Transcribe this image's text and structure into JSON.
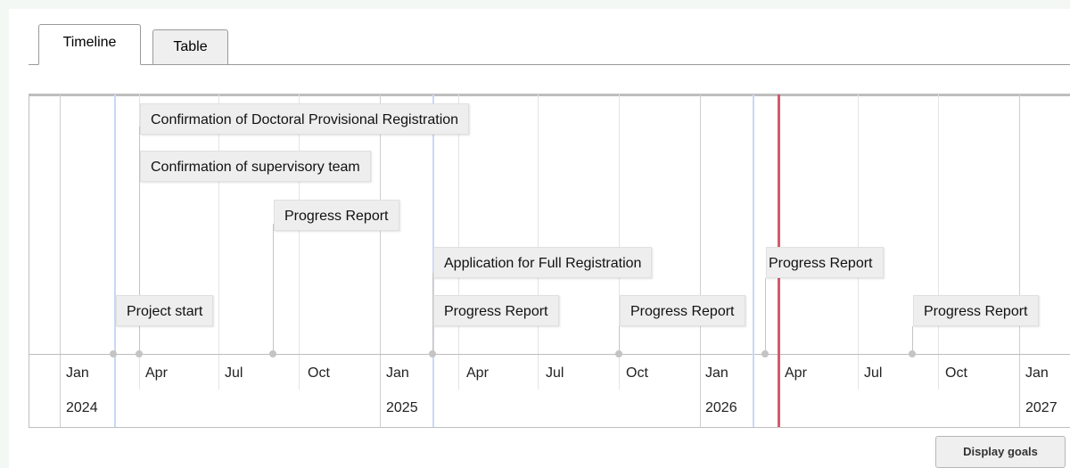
{
  "tabs": [
    {
      "label": "Timeline",
      "active": true
    },
    {
      "label": "Table",
      "active": false
    }
  ],
  "timeline": {
    "items": [
      {
        "label": "Confirmation of Doctoral Provisional Registration"
      },
      {
        "label": "Confirmation of supervisory team"
      },
      {
        "label": "Progress Report"
      },
      {
        "label": "Application for Full Registration"
      },
      {
        "label": "Progress Report"
      },
      {
        "label": "Project start"
      },
      {
        "label": "Progress Report"
      },
      {
        "label": "Progress Report"
      },
      {
        "label": "Progress Report"
      }
    ],
    "months": [
      "Jan",
      "Apr",
      "Jul",
      "Oct",
      "Jan",
      "Apr",
      "Jul",
      "Oct",
      "Jan",
      "Apr",
      "Jul",
      "Oct",
      "Jan"
    ],
    "years": [
      "2024",
      "2025",
      "2026",
      "2027"
    ],
    "colors": {
      "current_time_line": "#d45a6e",
      "marker_line": "#c9d8f5"
    }
  },
  "buttons": {
    "display_goals": "Display goals"
  }
}
